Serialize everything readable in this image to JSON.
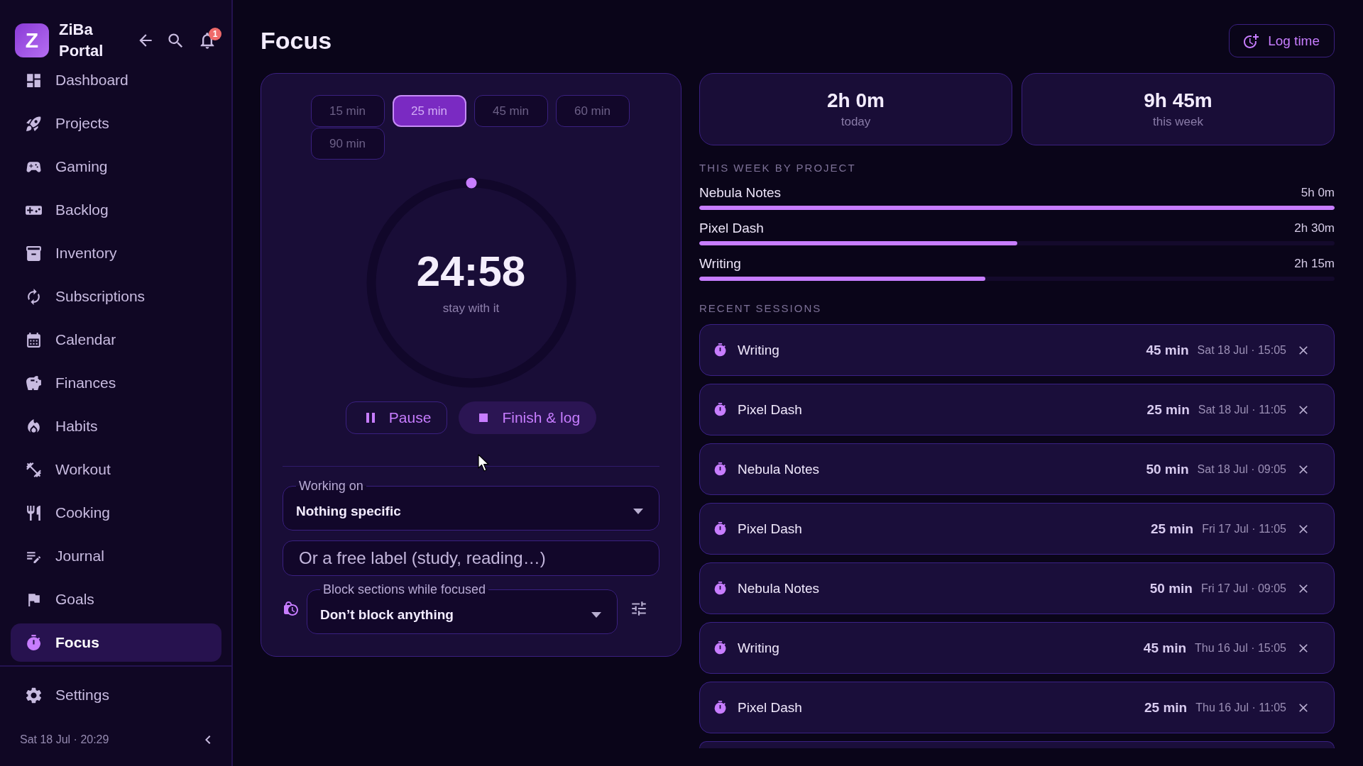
{
  "sidebar": {
    "brand": {
      "logo_letter": "Z",
      "name": "ZiBa Portal"
    },
    "notifications": {
      "count": "1"
    },
    "nav": [
      {
        "label": "Dashboard",
        "selected": false
      },
      {
        "label": "Projects",
        "selected": false
      },
      {
        "label": "Gaming",
        "selected": false
      },
      {
        "label": "Backlog",
        "selected": false
      },
      {
        "label": "Inventory",
        "selected": false
      },
      {
        "label": "Subscriptions",
        "selected": false
      },
      {
        "label": "Calendar",
        "selected": false
      },
      {
        "label": "Finances",
        "selected": false
      },
      {
        "label": "Habits",
        "selected": false
      },
      {
        "label": "Workout",
        "selected": false
      },
      {
        "label": "Cooking",
        "selected": false
      },
      {
        "label": "Journal",
        "selected": false
      },
      {
        "label": "Goals",
        "selected": false
      },
      {
        "label": "Focus",
        "selected": true
      }
    ],
    "settings": {
      "label": "Settings"
    },
    "datetime": "Sat 18 Jul · 20:29"
  },
  "page": {
    "title": "Focus",
    "log_time_button": "Log time"
  },
  "timer": {
    "durations": [
      {
        "label": "15 min",
        "selected": false
      },
      {
        "label": "25 min",
        "selected": true
      },
      {
        "label": "45 min",
        "selected": false
      },
      {
        "label": "60 min",
        "selected": false
      },
      {
        "label": "90 min",
        "selected": false
      }
    ],
    "time": "24:58",
    "caption": "stay with it",
    "actions": [
      {
        "kind": "pause",
        "label": "Pause"
      },
      {
        "kind": "finish",
        "label": "Finish & log"
      }
    ],
    "working_on": {
      "label": "Working on",
      "value": "Nothing specific"
    },
    "free_label": {
      "placeholder": "Or a free label (study, reading…)"
    },
    "block_sections": {
      "label": "Block sections while focused",
      "value": "Don’t block anything"
    }
  },
  "stats": [
    {
      "value": "2h 0m",
      "label": "today"
    },
    {
      "value": "9h 45m",
      "label": "this week"
    }
  ],
  "by_project": {
    "title": "THIS WEEK BY PROJECT",
    "projects": [
      {
        "name": "Nebula Notes",
        "total": "5h 0m",
        "level": 1
      },
      {
        "name": "Pixel Dash",
        "total": "2h 30m",
        "level": 0.5
      },
      {
        "name": "Writing",
        "total": "2h 15m",
        "level": 0.45
      }
    ]
  },
  "recent_sessions": {
    "title": "RECENT SESSIONS",
    "sessions": [
      {
        "name": "Writing",
        "duration": "45 min",
        "when": "Sat 18 Jul · 15:05"
      },
      {
        "name": "Pixel Dash",
        "duration": "25 min",
        "when": "Sat 18 Jul · 11:05"
      },
      {
        "name": "Nebula Notes",
        "duration": "50 min",
        "when": "Sat 18 Jul · 09:05"
      },
      {
        "name": "Pixel Dash",
        "duration": "25 min",
        "when": "Fri 17 Jul · 11:05"
      },
      {
        "name": "Nebula Notes",
        "duration": "50 min",
        "when": "Fri 17 Jul · 09:05"
      },
      {
        "name": "Writing",
        "duration": "45 min",
        "when": "Thu 16 Jul · 15:05"
      },
      {
        "name": "Pixel Dash",
        "duration": "25 min",
        "when": "Thu 16 Jul · 11:05"
      }
    ]
  }
}
